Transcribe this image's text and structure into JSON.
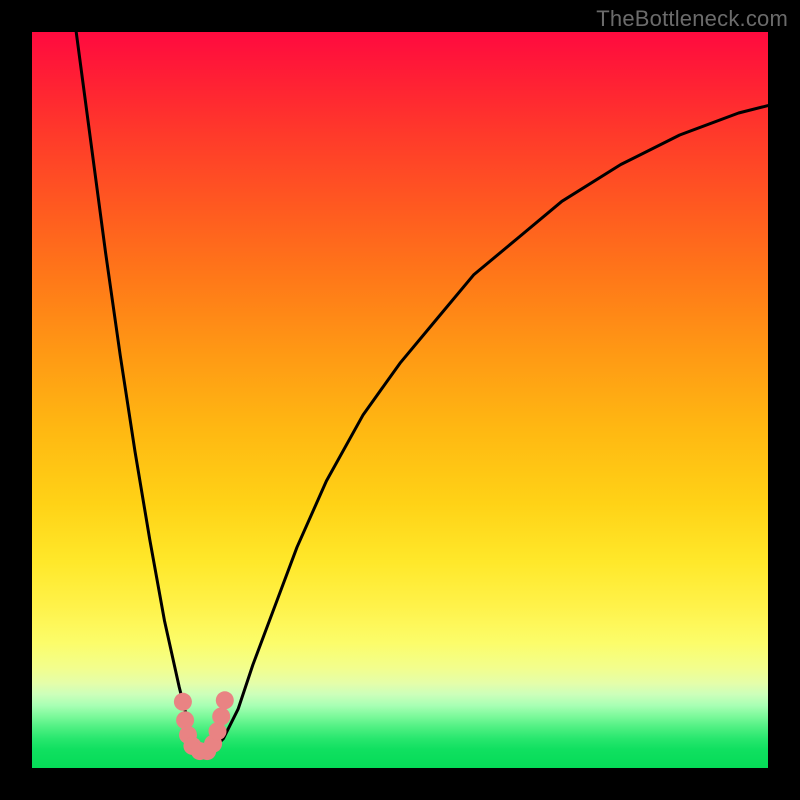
{
  "attribution": "TheBottleneck.com",
  "colors": {
    "frame": "#000000",
    "gradient_top": "#ff0a3f",
    "gradient_mid_orange": "#ff7a18",
    "gradient_mid_yellow": "#ffe82a",
    "gradient_bottom": "#05db57",
    "curve_stroke": "#000000",
    "marker_fill": "#e98383",
    "attribution_text": "#6b6b6b"
  },
  "chart_data": {
    "type": "line",
    "title": "",
    "xlabel": "",
    "ylabel": "",
    "x_range": [
      0,
      100
    ],
    "y_range": [
      0,
      100
    ],
    "series": [
      {
        "name": "bottleneck-curve",
        "x": [
          6,
          8,
          10,
          12,
          14,
          16,
          18,
          20,
          21,
          22,
          23,
          24,
          26,
          28,
          30,
          33,
          36,
          40,
          45,
          50,
          55,
          60,
          66,
          72,
          80,
          88,
          96,
          100
        ],
        "y": [
          100,
          85,
          70,
          56,
          43,
          31,
          20,
          11,
          7,
          4,
          2,
          2,
          4,
          8,
          14,
          22,
          30,
          39,
          48,
          55,
          61,
          67,
          72,
          77,
          82,
          86,
          89,
          90
        ]
      }
    ],
    "markers": [
      {
        "x": 20.5,
        "y": 9.0
      },
      {
        "x": 20.8,
        "y": 6.5
      },
      {
        "x": 21.2,
        "y": 4.5
      },
      {
        "x": 21.8,
        "y": 3.0
      },
      {
        "x": 22.8,
        "y": 2.3
      },
      {
        "x": 23.8,
        "y": 2.3
      },
      {
        "x": 24.6,
        "y": 3.3
      },
      {
        "x": 25.2,
        "y": 5.0
      },
      {
        "x": 25.7,
        "y": 7.0
      },
      {
        "x": 26.2,
        "y": 9.2
      }
    ],
    "notes": "x and y are percentages of plot width/height; y=0 at bottom (green), y=100 at top (red). Curve descends steeply from top-left, reaches minimum near x≈23, then rises with decreasing slope toward upper-right. Salmon markers cluster around the trough."
  }
}
